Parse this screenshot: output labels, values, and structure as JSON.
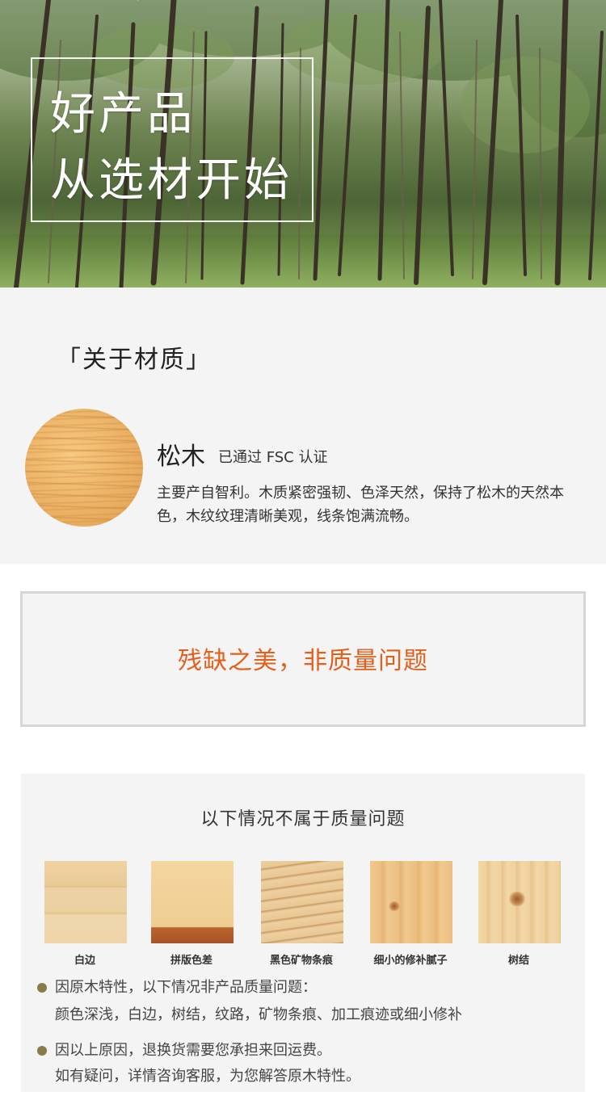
{
  "hero": {
    "line1": "好产品",
    "line2": "从选材开始"
  },
  "material": {
    "section_title": "「关于材质」",
    "wood_name": "松木",
    "certification": "已通过 FSC 认证",
    "description": "主要产自智利。木质紧密强韧、色泽天然，保持了松木的天然本色，木纹纹理清晰美观，线条饱满流畅。"
  },
  "notice": {
    "text": "残缺之美，非质量问题"
  },
  "conditions": {
    "title": "以下情况不属于质量问题",
    "items": [
      {
        "label": "白边"
      },
      {
        "label": "拼版色差"
      },
      {
        "label": "黑色矿物条痕"
      },
      {
        "label": "细小的修补腻子"
      },
      {
        "label": "树结"
      }
    ],
    "notes": [
      {
        "line1": "因原木特性，以下情况非产品质量问题：",
        "line2": "颜色深浅，白边，树结，纹路，矿物条痕、加工痕迹或细小修补"
      },
      {
        "line1": "因以上原因，退换货需要您承担来回运费。",
        "line2": "如有疑问，详情咨询客服，为您解答原木特性。"
      }
    ]
  },
  "colors": {
    "accent_orange": "#e3601c",
    "bullet_brown": "#8a7a4a",
    "section_bg": "#f4f4f4"
  }
}
